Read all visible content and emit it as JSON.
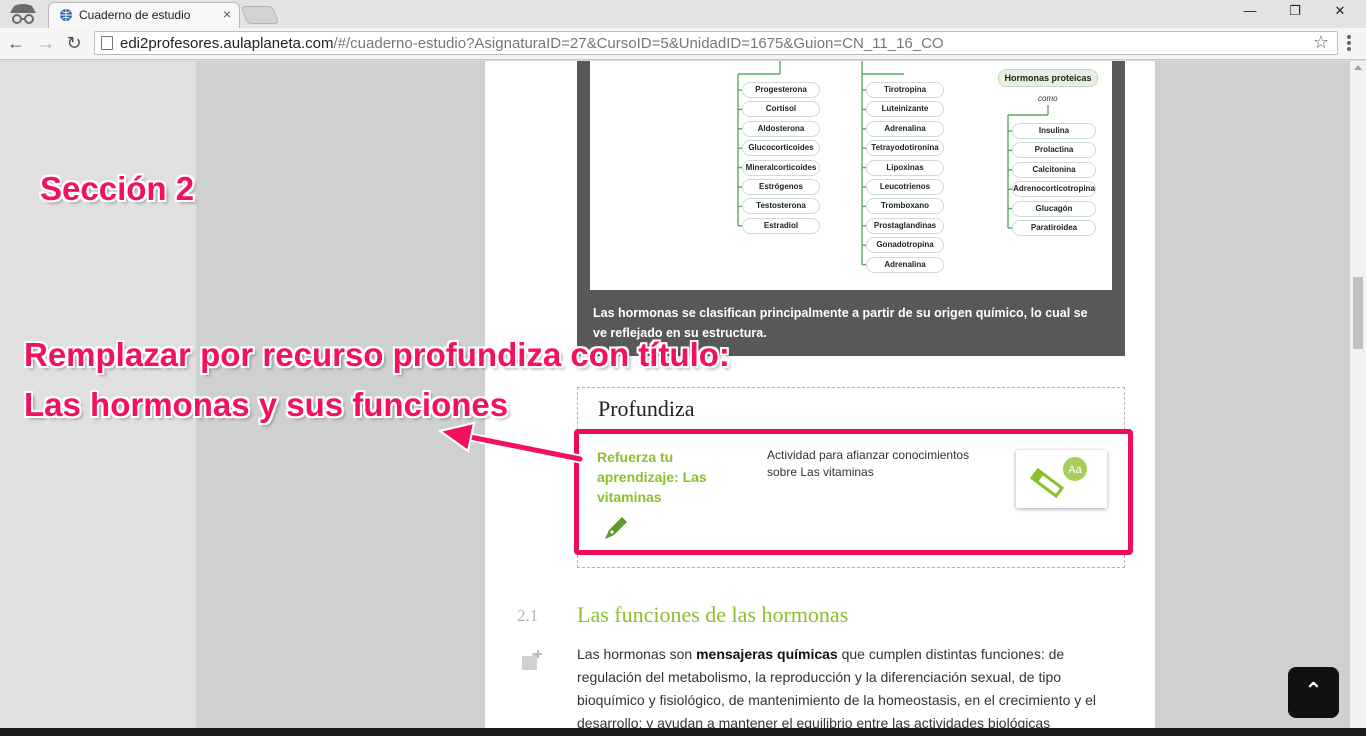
{
  "browser": {
    "tab_title": "Cuaderno de estudio",
    "tab_close": "×",
    "url_host": "edi2profesores.aulaplaneta.com",
    "url_rest": "/#/cuaderno-estudio?AsignaturaID=27&CursoID=5&UnidadID=1675&Guion=CN_11_16_CO",
    "back": "←",
    "forward": "→",
    "reload": "↻",
    "star": "☆",
    "minimize": "—",
    "restore": "❐",
    "close": "✕"
  },
  "diagram": {
    "column1": [
      "Progesterona",
      "Cortisol",
      "Aldosterona",
      "Glucocorticoides",
      "Mineralcorticoides",
      "Estrógenos",
      "Testosterona",
      "Estradiol"
    ],
    "column2": [
      "Tirotropina",
      "Luteinizante",
      "Adrenalina",
      "Tetrayodotironina",
      "Lipoxinas",
      "Leucotrienos",
      "Tromboxano",
      "Prostaglandinas",
      "Gonadotropina",
      "Adrenalina"
    ],
    "column3_header": "Hormonas proteicas",
    "column3_connector": "como",
    "column3": [
      "Insulina",
      "Prolactina",
      "Calcitonina",
      "Adrenocorticotropina",
      "Glucagón",
      "Paratiroidea"
    ],
    "line_color": "#5aa869"
  },
  "figure": {
    "caption": "Las hormonas se clasifican principalmente a partir de su origen químico, lo cual se ve reflejado en su estructura."
  },
  "profundiza": {
    "title": "Profundiza",
    "card": {
      "title": "Refuerza tu aprendizaje: Las vitaminas",
      "description": "Actividad para afianzar conocimientos sobre Las vitaminas",
      "thumb_badge": "Aa"
    }
  },
  "section": {
    "number": "2.1",
    "title": "Las funciones de las hormonas",
    "paragraph_start": "Las hormonas son ",
    "paragraph_bold": "mensajeras químicas",
    "paragraph_end": " que cumplen distintas funciones: de regulación del metabolismo, la reproducción y la diferenciación sexual, de tipo bioquímico y fisiológico, de mantenimiento de la homeostasis, en el crecimiento y el desarrollo; y ayudan a mantener el equilibrio entre las actividades biológicas"
  },
  "annotations": {
    "section_label": "Sección 2",
    "line1": "Remplazar por recurso profundiza con título:",
    "line2": "Las hormonas y sus funciones"
  },
  "scroll_top_glyph": "⌃",
  "colors": {
    "accent_green": "#8cbf2e",
    "annotation_pink": "#f5105e",
    "figure_bg": "#58585a"
  }
}
